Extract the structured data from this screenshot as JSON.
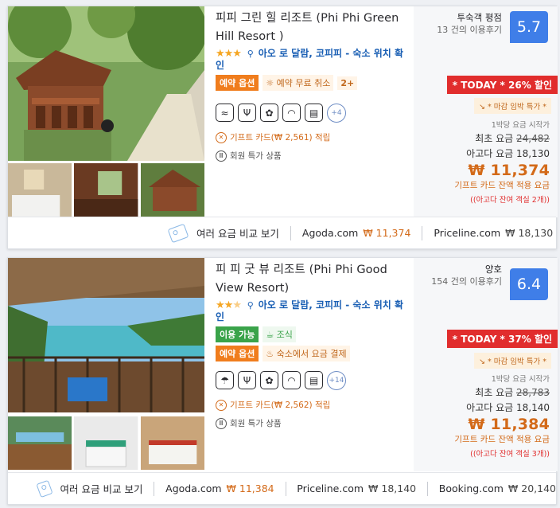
{
  "hotels": [
    {
      "title": "피피 그린 힐 리조트 (Phi Phi Green Hill Resort )",
      "stars": "★★★",
      "location": "아오 로 달람, 코피피 - 숙소 위치 확인",
      "badges": [
        {
          "label": "예약 옵션",
          "style": "orange"
        },
        {
          "label": "예약 무료 취소",
          "style": "plain"
        },
        {
          "label": "2+",
          "style": "count"
        }
      ],
      "amenities": [
        "swimming-pool-icon",
        "restaurant-icon",
        "spa-icon",
        "wifi-icon",
        "air-conditioning-icon"
      ],
      "amenities_more": "+4",
      "gift_card": "기프트 카드(₩ 2,561) 적립",
      "member_deal": "회원 특가 상품",
      "review_label": "투숙객 평점",
      "review_count": "13 건의 이용후기",
      "score": "5.7",
      "today_deal": "* TODAY * 26% 할인",
      "deadline": "↘ * 마감 임박 특가 *",
      "price_from_label": "1박당 요금 시작가",
      "orig_label": "최초 요금",
      "orig_price": "24,482",
      "agoda_price": "아고다 요금 18,130",
      "final_price": "₩ 11,374",
      "gift_note": "기프트 카드 잔액 적용 요금",
      "remaining": "((아고다 잔여 객실 2개))",
      "compare_label": "여러 요금 비교 보기",
      "sites": [
        {
          "name": "Agoda.com",
          "price": "₩ 11,374",
          "highlight": true
        },
        {
          "name": "Priceline.com",
          "price": "₩ 18,130",
          "highlight": false
        }
      ]
    },
    {
      "title": "피 피 굿 뷰 리조트 (Phi Phi Good View Resort)",
      "stars": "★★",
      "half_star": "★",
      "location": "아오 로 달람, 코피피 - 숙소 위치 확인",
      "badges_row1": [
        {
          "label": "이용 가능",
          "style": "green"
        },
        {
          "label": "조식",
          "style": "plain-green"
        }
      ],
      "badges": [
        {
          "label": "예약 옵션",
          "style": "orange"
        },
        {
          "label": "숙소에서 요금 결제",
          "style": "plain"
        }
      ],
      "amenities": [
        "beach-umbrella-icon",
        "restaurant-icon",
        "spa-icon",
        "wifi-icon",
        "air-conditioning-icon"
      ],
      "amenities_more": "+14",
      "gift_card": "기프트 카드(₩ 2,562) 적립",
      "member_deal": "회원 특가 상품",
      "review_label": "양호",
      "review_count": "154 건의 이용후기",
      "score": "6.4",
      "today_deal": "* TODAY * 37% 할인",
      "deadline": "↘ * 마감 임박 특가 *",
      "price_from_label": "1박당 요금 시작가",
      "orig_label": "최초 요금",
      "orig_price": "28,783",
      "agoda_price": "아고다 요금 18,140",
      "final_price": "₩ 11,384",
      "gift_note": "기프트 카드 잔액 적용 요금",
      "remaining": "((아고다 잔여 객실 3개))",
      "compare_label": "여러 요금 비교 보기",
      "sites": [
        {
          "name": "Agoda.com",
          "price": "₩ 11,384",
          "highlight": true
        },
        {
          "name": "Priceline.com",
          "price": "₩ 18,140",
          "highlight": false
        },
        {
          "name": "Booking.com",
          "price": "₩ 20,140",
          "highlight": false
        }
      ]
    }
  ]
}
